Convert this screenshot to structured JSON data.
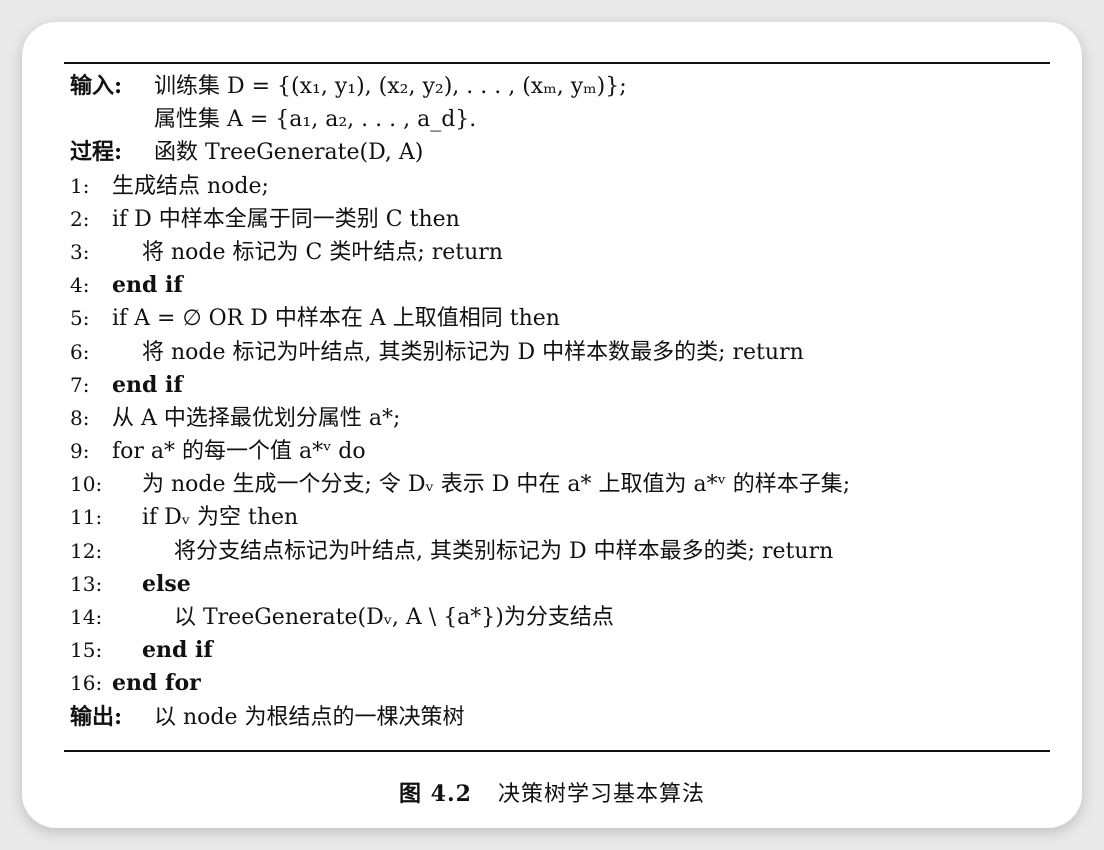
{
  "header": {
    "input_label": "输入:",
    "input_line1": "训练集 D = {(x₁, y₁), (x₂, y₂), . . . , (xₘ, yₘ)};",
    "input_line2": "属性集 A = {a₁, a₂, . . . , a_d}.",
    "process_label": "过程:",
    "process_text": "函数 TreeGenerate(D, A)"
  },
  "steps": [
    {
      "num": "1:",
      "text": "生成结点 node;"
    },
    {
      "num": "2:",
      "text": "if D 中样本全属于同一类别 C  then"
    },
    {
      "num": "3:",
      "text": "将 node 标记为 C 类叶结点; return"
    },
    {
      "num": "4:",
      "text": "end if"
    },
    {
      "num": "5:",
      "text": "if A = ∅  OR D 中样本在 A 上取值相同 then"
    },
    {
      "num": "6:",
      "text": "将 node 标记为叶结点, 其类别标记为 D 中样本数最多的类; return"
    },
    {
      "num": "7:",
      "text": "end if"
    },
    {
      "num": "8:",
      "text": "从 A 中选择最优划分属性 a*;"
    },
    {
      "num": "9:",
      "text": "for a* 的每一个值 a*ᵛ do"
    },
    {
      "num": "10:",
      "text": "为 node 生成一个分支; 令 Dᵥ 表示 D 中在 a* 上取值为 a*ᵛ 的样本子集;"
    },
    {
      "num": "11:",
      "text": "if Dᵥ 为空 then"
    },
    {
      "num": "12:",
      "text": "将分支结点标记为叶结点, 其类别标记为 D 中样本最多的类; return"
    },
    {
      "num": "13:",
      "text": "else"
    },
    {
      "num": "14:",
      "text": "以 TreeGenerate(Dᵥ, A \\ {a*})为分支结点"
    },
    {
      "num": "15:",
      "text": "end if"
    },
    {
      "num": "16:",
      "text": "end for"
    }
  ],
  "footer": {
    "output_label": "输出:",
    "output_text": "以 node 为根结点的一棵决策树"
  },
  "caption": {
    "figure_number": "图 4.2",
    "title": "决策树学习基本算法"
  }
}
